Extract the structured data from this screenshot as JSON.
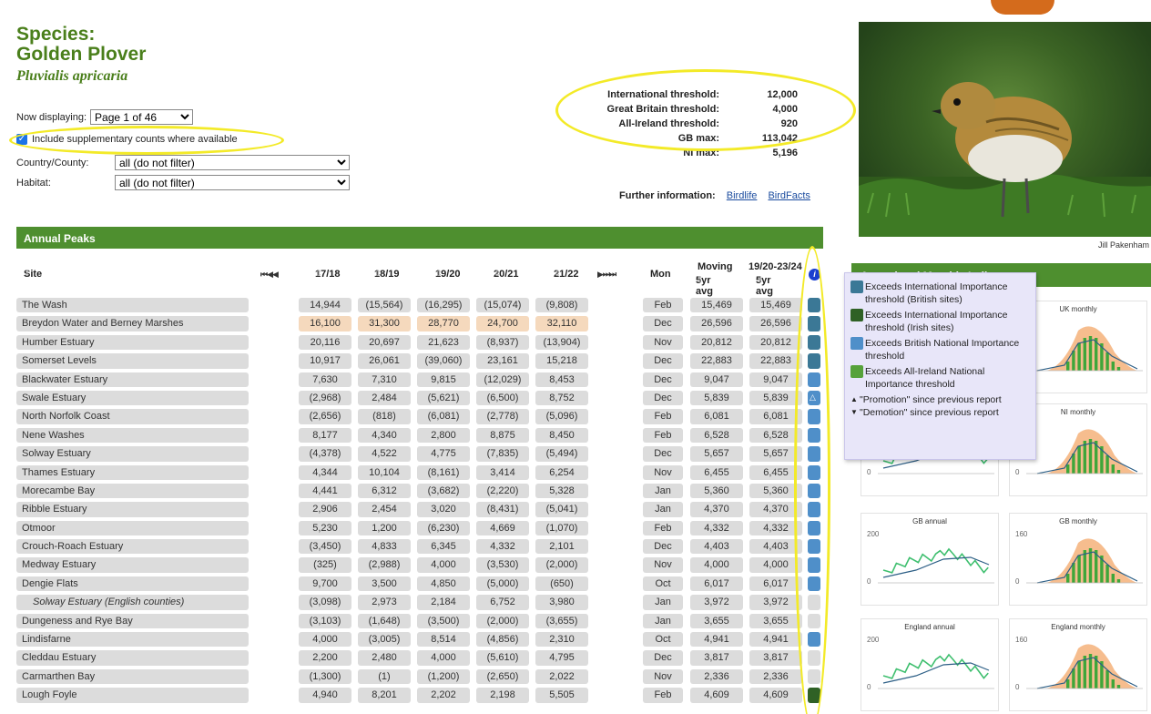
{
  "species": {
    "label": "Species:",
    "common_name": "Golden Plover",
    "latin_name": "Pluvialis apricaria"
  },
  "controls": {
    "now_displaying_label": "Now displaying:",
    "page_value": "Page 1 of 46",
    "supplementary_label": "Include supplementary counts where available",
    "country_label": "Country/County:",
    "country_value": "all (do not filter)",
    "habitat_label": "Habitat:",
    "habitat_value": "all (do not filter)"
  },
  "thresholds": [
    {
      "label": "International threshold:",
      "value": "12,000"
    },
    {
      "label": "Great Britain threshold:",
      "value": "4,000"
    },
    {
      "label": "All-Ireland threshold:",
      "value": "920"
    },
    {
      "label": "GB max:",
      "value": "113,042"
    },
    {
      "label": "NI max:",
      "value": "5,196"
    }
  ],
  "further": {
    "label": "Further information:",
    "links": [
      "Birdlife",
      "BirdFacts"
    ]
  },
  "photo_credit": "Jill Pakenham",
  "annual_peaks": {
    "title": "Annual Peaks",
    "headers": {
      "site": "Site",
      "y1": "17/18",
      "y2": "18/19",
      "y3": "19/20",
      "y4": "20/21",
      "y5": "21/22",
      "mon": "Mon",
      "moving_1": "Moving",
      "moving_2": "5yr avg",
      "avg_1": "19/20-23/24",
      "avg_2": "5yr avg",
      "nav_prev": "⏮◀◀",
      "nav_next": "▶⏭⏭",
      "info": "i"
    },
    "rows": [
      {
        "site": "The Wash",
        "vals": [
          "14,944",
          "(15,564)",
          "(16,295)",
          "(15,074)",
          "(9,808)"
        ],
        "mon": "Feb",
        "mov": "15,469",
        "avg": "15,469",
        "status": "intl"
      },
      {
        "site": "Breydon Water and Berney Marshes",
        "vals": [
          "16,100",
          "31,300",
          "28,770",
          "24,700",
          "32,110"
        ],
        "mon": "Dec",
        "mov": "26,596",
        "avg": "26,596",
        "status": "intl",
        "highlight": true
      },
      {
        "site": "Humber Estuary",
        "vals": [
          "20,116",
          "20,697",
          "21,623",
          "(8,937)",
          "(13,904)"
        ],
        "mon": "Nov",
        "mov": "20,812",
        "avg": "20,812",
        "status": "intl"
      },
      {
        "site": "Somerset Levels",
        "vals": [
          "10,917",
          "26,061",
          "(39,060)",
          "23,161",
          "15,218"
        ],
        "mon": "Dec",
        "mov": "22,883",
        "avg": "22,883",
        "status": "intl"
      },
      {
        "site": "Blackwater Estuary",
        "vals": [
          "7,630",
          "7,310",
          "9,815",
          "(12,029)",
          "8,453"
        ],
        "mon": "Dec",
        "mov": "9,047",
        "avg": "9,047",
        "status": "gb"
      },
      {
        "site": "Swale Estuary",
        "vals": [
          "(2,968)",
          "2,484",
          "(5,621)",
          "(6,500)",
          "8,752"
        ],
        "mon": "Dec",
        "mov": "5,839",
        "avg": "5,839",
        "status": "gb-up"
      },
      {
        "site": "North Norfolk Coast",
        "vals": [
          "(2,656)",
          "(818)",
          "(6,081)",
          "(2,778)",
          "(5,096)"
        ],
        "mon": "Feb",
        "mov": "6,081",
        "avg": "6,081",
        "status": "gb"
      },
      {
        "site": "Nene Washes",
        "vals": [
          "8,177",
          "4,340",
          "2,800",
          "8,875",
          "8,450"
        ],
        "mon": "Feb",
        "mov": "6,528",
        "avg": "6,528",
        "status": "gb"
      },
      {
        "site": "Solway Estuary",
        "vals": [
          "(4,378)",
          "4,522",
          "4,775",
          "(7,835)",
          "(5,494)"
        ],
        "mon": "Dec",
        "mov": "5,657",
        "avg": "5,657",
        "status": "gb"
      },
      {
        "site": "Thames Estuary",
        "vals": [
          "4,344",
          "10,104",
          "(8,161)",
          "3,414",
          "6,254"
        ],
        "mon": "Nov",
        "mov": "6,455",
        "avg": "6,455",
        "status": "gb"
      },
      {
        "site": "Morecambe Bay",
        "vals": [
          "4,441",
          "6,312",
          "(3,682)",
          "(2,220)",
          "5,328"
        ],
        "mon": "Jan",
        "mov": "5,360",
        "avg": "5,360",
        "status": "gb"
      },
      {
        "site": "Ribble Estuary",
        "vals": [
          "2,906",
          "2,454",
          "3,020",
          "(8,431)",
          "(5,041)"
        ],
        "mon": "Jan",
        "mov": "4,370",
        "avg": "4,370",
        "status": "gb"
      },
      {
        "site": "Otmoor",
        "vals": [
          "5,230",
          "1,200",
          "(6,230)",
          "4,669",
          "(1,070)"
        ],
        "mon": "Feb",
        "mov": "4,332",
        "avg": "4,332",
        "status": "gb"
      },
      {
        "site": "Crouch-Roach Estuary",
        "vals": [
          "(3,450)",
          "4,833",
          "6,345",
          "4,332",
          "2,101"
        ],
        "mon": "Dec",
        "mov": "4,403",
        "avg": "4,403",
        "status": "gb"
      },
      {
        "site": "Medway Estuary",
        "vals": [
          "(325)",
          "(2,988)",
          "4,000",
          "(3,530)",
          "(2,000)"
        ],
        "mon": "Nov",
        "mov": "4,000",
        "avg": "4,000",
        "status": "gb"
      },
      {
        "site": "Dengie Flats",
        "vals": [
          "9,700",
          "3,500",
          "4,850",
          "(5,000)",
          "(650)"
        ],
        "mon": "Oct",
        "mov": "6,017",
        "avg": "6,017",
        "status": "gb"
      },
      {
        "site": "Solway Estuary (English counties)",
        "vals": [
          "(3,098)",
          "2,973",
          "2,184",
          "6,752",
          "3,980"
        ],
        "mon": "Jan",
        "mov": "3,972",
        "avg": "3,972",
        "status": "none",
        "indent": true
      },
      {
        "site": "Dungeness and Rye Bay",
        "vals": [
          "(3,103)",
          "(1,648)",
          "(3,500)",
          "(2,000)",
          "(3,655)"
        ],
        "mon": "Jan",
        "mov": "3,655",
        "avg": "3,655",
        "status": "none"
      },
      {
        "site": "Lindisfarne",
        "vals": [
          "4,000",
          "(3,005)",
          "8,514",
          "(4,856)",
          "2,310"
        ],
        "mon": "Oct",
        "mov": "4,941",
        "avg": "4,941",
        "status": "gb"
      },
      {
        "site": "Cleddau Estuary",
        "vals": [
          "2,200",
          "2,480",
          "4,000",
          "(5,610)",
          "4,795"
        ],
        "mon": "Dec",
        "mov": "3,817",
        "avg": "3,817",
        "status": "none"
      },
      {
        "site": "Carmarthen Bay",
        "vals": [
          "(1,300)",
          "(1)",
          "(1,200)",
          "(2,650)",
          "2,022"
        ],
        "mon": "Nov",
        "mov": "2,336",
        "avg": "2,336",
        "status": "none"
      },
      {
        "site": "Lough Foyle",
        "vals": [
          "4,940",
          "8,201",
          "2,202",
          "2,198",
          "5,505"
        ],
        "mon": "Feb",
        "mov": "4,609",
        "avg": "4,609",
        "status": "intl-ie"
      }
    ]
  },
  "legend": {
    "items": [
      {
        "color": "#3b7896",
        "text": "Exceeds International Importance threshold (British sites)"
      },
      {
        "color": "#2f6125",
        "text": "Exceeds International Importance threshold (Irish sites)"
      },
      {
        "color": "#4f8fc9",
        "text": "Exceeds British National Importance threshold"
      },
      {
        "color": "#56a23a",
        "text": "Exceeds All-Ireland National Importance threshold"
      }
    ],
    "promotion": "\"Promotion\" since previous report",
    "demotion": "\"Demotion\" since previous report"
  },
  "right_panel": {
    "title": "Annual and Monthly Indices"
  },
  "mini_charts": [
    {
      "id": "uk-annual",
      "title": "",
      "type": "annual",
      "ymax": ""
    },
    {
      "id": "uk-monthly",
      "title": "UK monthly",
      "type": "monthly",
      "ymax": ""
    },
    {
      "id": "ni-annual",
      "title": "",
      "type": "annual",
      "ymax": "",
      "y0": "0"
    },
    {
      "id": "ni-monthly",
      "title": "NI monthly",
      "type": "monthly",
      "ymax": "",
      "y0": "0"
    },
    {
      "id": "gb-annual",
      "title": "GB annual",
      "type": "annual",
      "ymax": "200",
      "y0": "0"
    },
    {
      "id": "gb-monthly",
      "title": "GB monthly",
      "type": "monthly",
      "ymax": "160",
      "y0": "0"
    },
    {
      "id": "eng-annual",
      "title": "England annual",
      "type": "annual",
      "ymax": "200",
      "y0": "0"
    },
    {
      "id": "eng-monthly",
      "title": "England monthly",
      "type": "monthly",
      "ymax": "160",
      "y0": "0"
    }
  ],
  "colors": {
    "accent_green": "#4e8f2f",
    "title_green": "#4a7f1b",
    "highlight": "#f5d9bd",
    "annotation_yellow": "#f3ea28"
  }
}
